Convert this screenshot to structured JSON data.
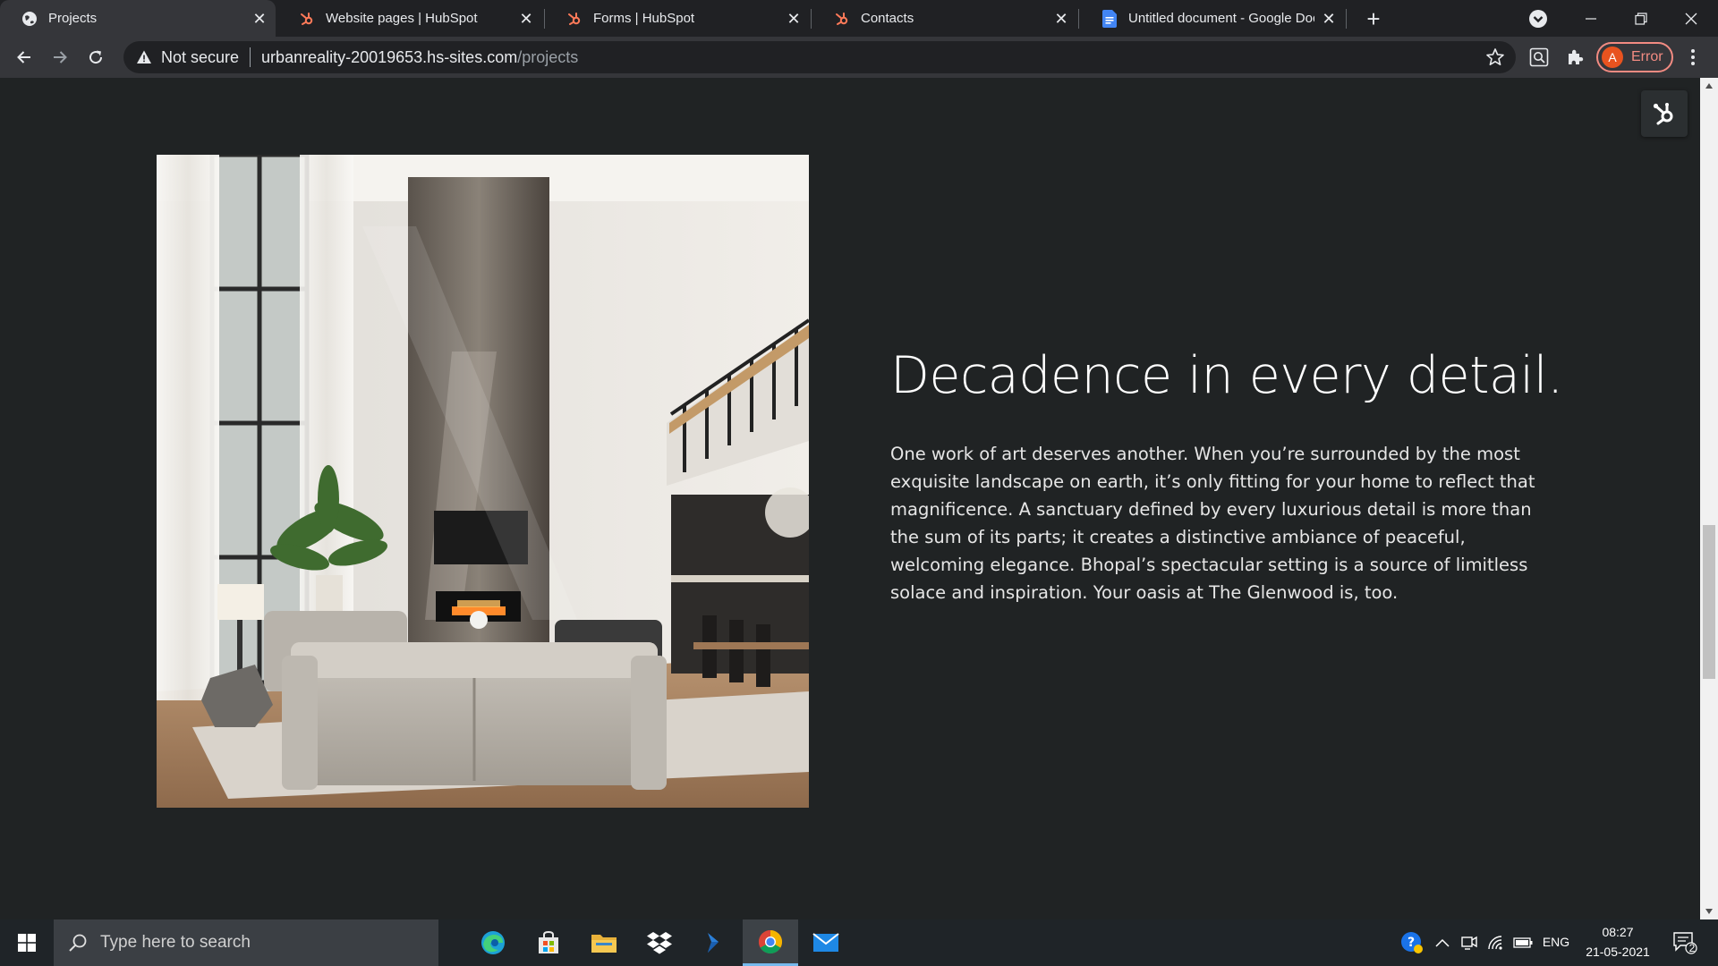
{
  "tabs": [
    {
      "title": "Projects",
      "active": true
    },
    {
      "title": "Website pages | HubSpot",
      "active": false
    },
    {
      "title": "Forms | HubSpot",
      "active": false
    },
    {
      "title": "Contacts",
      "active": false
    },
    {
      "title": "Untitled document - Google Docs",
      "active": false
    }
  ],
  "address_bar": {
    "security_label": "Not secure",
    "host": "urbanreality-20019653.hs-sites.com",
    "path": "/projects"
  },
  "profile": {
    "initial": "A",
    "status": "Error"
  },
  "content": {
    "headline": "Decadence in every detail.",
    "body": "One work of art deserves another. When you’re surrounded by the most exquisite landscape on earth, it’s only fitting for your home to reflect that magnificence. A sanctuary defined by every luxurious detail is more than the sum of its parts; it creates a distinctive ambiance of peaceful, welcoming elegance. Bhopal’s spectacular setting is a source of limitless solace and inspiration. Your oasis at The Glenwood is, too."
  },
  "taskbar": {
    "search_placeholder": "Type here to search",
    "language": "ENG",
    "time": "08:27",
    "date": "21-05-2021",
    "notification_count": "2"
  },
  "colors": {
    "hubspot_orange": "#ff7a59",
    "page_background": "#202324",
    "profile_error": "#f28b82"
  }
}
